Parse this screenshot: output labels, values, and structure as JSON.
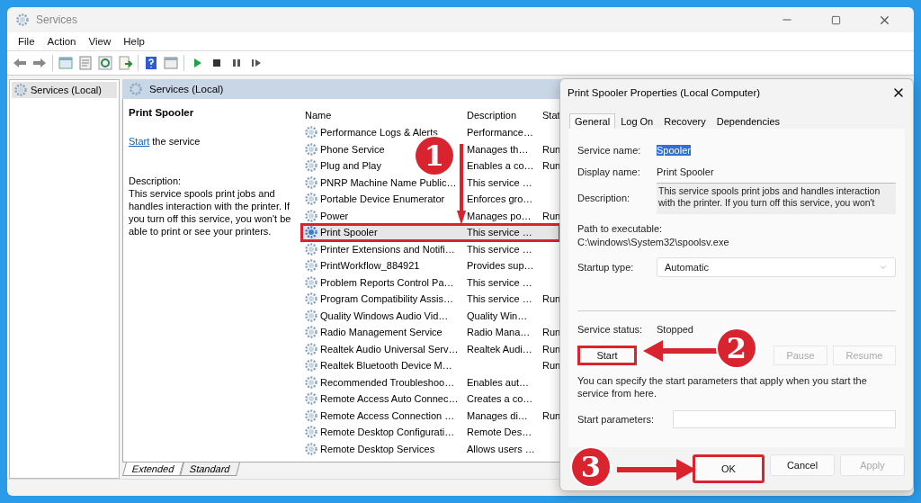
{
  "window": {
    "title": "Services"
  },
  "menu": [
    "File",
    "Action",
    "View",
    "Help"
  ],
  "tree": {
    "items": [
      {
        "label": "Services (Local)",
        "selected": true
      }
    ]
  },
  "pane": {
    "title": "Services (Local)"
  },
  "details": {
    "service": "Print Spooler",
    "link": "Start",
    "link_rest": "the service",
    "description_label": "Description:",
    "description": "This service spools print jobs and handles interaction with the printer. If you turn off this service, you won't be able to print or see your printers."
  },
  "table": {
    "columns": [
      "Name",
      "Description",
      "Stat"
    ],
    "rows": [
      {
        "name": "Performance Logs & Alerts",
        "description": "Performance…",
        "status": "",
        "selected": false,
        "outlined": false
      },
      {
        "name": "Phone Service",
        "description": "Manages th…",
        "status": "Run",
        "selected": false,
        "outlined": false
      },
      {
        "name": "Plug and Play",
        "description": "Enables a co…",
        "status": "Run",
        "selected": false,
        "outlined": false
      },
      {
        "name": "PNRP Machine Name Public…",
        "description": "This service …",
        "status": "",
        "selected": false,
        "outlined": false
      },
      {
        "name": "Portable Device Enumerator",
        "description": "Enforces gro…",
        "status": "",
        "selected": false,
        "outlined": false
      },
      {
        "name": "Power",
        "description": "Manages po…",
        "status": "Run",
        "selected": false,
        "outlined": false
      },
      {
        "name": "Print Spooler",
        "description": "This service …",
        "status": "",
        "selected": true,
        "outlined": true
      },
      {
        "name": "Printer Extensions and Notifi…",
        "description": "This service …",
        "status": "",
        "selected": false,
        "outlined": false
      },
      {
        "name": "PrintWorkflow_884921",
        "description": "Provides sup…",
        "status": "",
        "selected": false,
        "outlined": false
      },
      {
        "name": "Problem Reports Control Pa…",
        "description": "This service …",
        "status": "",
        "selected": false,
        "outlined": false
      },
      {
        "name": "Program Compatibility Assis…",
        "description": "This service …",
        "status": "Run",
        "selected": false,
        "outlined": false
      },
      {
        "name": "Quality Windows Audio Vid…",
        "description": "Quality Win…",
        "status": "",
        "selected": false,
        "outlined": false
      },
      {
        "name": "Radio Management Service",
        "description": "Radio Mana…",
        "status": "Run",
        "selected": false,
        "outlined": false
      },
      {
        "name": "Realtek Audio Universal Serv…",
        "description": "Realtek Audi…",
        "status": "Run",
        "selected": false,
        "outlined": false
      },
      {
        "name": "Realtek Bluetooth Device M…",
        "description": "",
        "status": "Run",
        "selected": false,
        "outlined": false
      },
      {
        "name": "Recommended Troubleshoo…",
        "description": "Enables aut…",
        "status": "",
        "selected": false,
        "outlined": false
      },
      {
        "name": "Remote Access Auto Connec…",
        "description": "Creates a co…",
        "status": "",
        "selected": false,
        "outlined": false
      },
      {
        "name": "Remote Access Connection …",
        "description": "Manages di…",
        "status": "Run",
        "selected": false,
        "outlined": false
      },
      {
        "name": "Remote Desktop Configurati…",
        "description": "Remote Des…",
        "status": "",
        "selected": false,
        "outlined": false
      },
      {
        "name": "Remote Desktop Services",
        "description": "Allows users …",
        "status": "",
        "selected": false,
        "outlined": false
      }
    ]
  },
  "view_tabs": [
    {
      "label": "Extended",
      "selected": true
    },
    {
      "label": "Standard",
      "selected": false
    }
  ],
  "dialog": {
    "title": "Print Spooler Properties (Local Computer)",
    "tabs": [
      {
        "label": "General",
        "selected": true
      },
      {
        "label": "Log On",
        "selected": false
      },
      {
        "label": "Recovery",
        "selected": false
      },
      {
        "label": "Dependencies",
        "selected": false
      }
    ],
    "fields": [
      {
        "label": "Service name:",
        "value": "Spooler",
        "kind": "highlighted"
      },
      {
        "label": "Display name:",
        "value": "Print Spooler",
        "kind": "text"
      },
      {
        "label": "Description:",
        "value": "This service spools print jobs and handles interaction\nwith the printer.  If you turn off this service, you won't",
        "kind": "textarea"
      }
    ],
    "path_label": "Path to executable:",
    "path": "C:\\windows\\System32\\spoolsv.exe",
    "startup": {
      "label": "Startup type:",
      "value": "Automatic"
    },
    "status": {
      "label": "Service status:",
      "value": "Stopped"
    },
    "service_buttons": [
      {
        "label": "Start",
        "disabled": false,
        "outlined": true
      },
      {
        "label": "Pause",
        "disabled": true,
        "outlined": false
      },
      {
        "label": "Resume",
        "disabled": true,
        "outlined": false
      }
    ],
    "hint": "You can specify the start parameters that apply when you start the service from here.",
    "params": {
      "label": "Start parameters:"
    },
    "buttons": [
      {
        "label": "OK",
        "disabled": false,
        "outlined": true
      },
      {
        "label": "Cancel",
        "disabled": false,
        "outlined": false
      },
      {
        "label": "Apply",
        "disabled": true,
        "outlined": false
      }
    ]
  },
  "annotations": [
    {
      "label": "1"
    },
    {
      "label": "2"
    },
    {
      "label": "3"
    }
  ]
}
